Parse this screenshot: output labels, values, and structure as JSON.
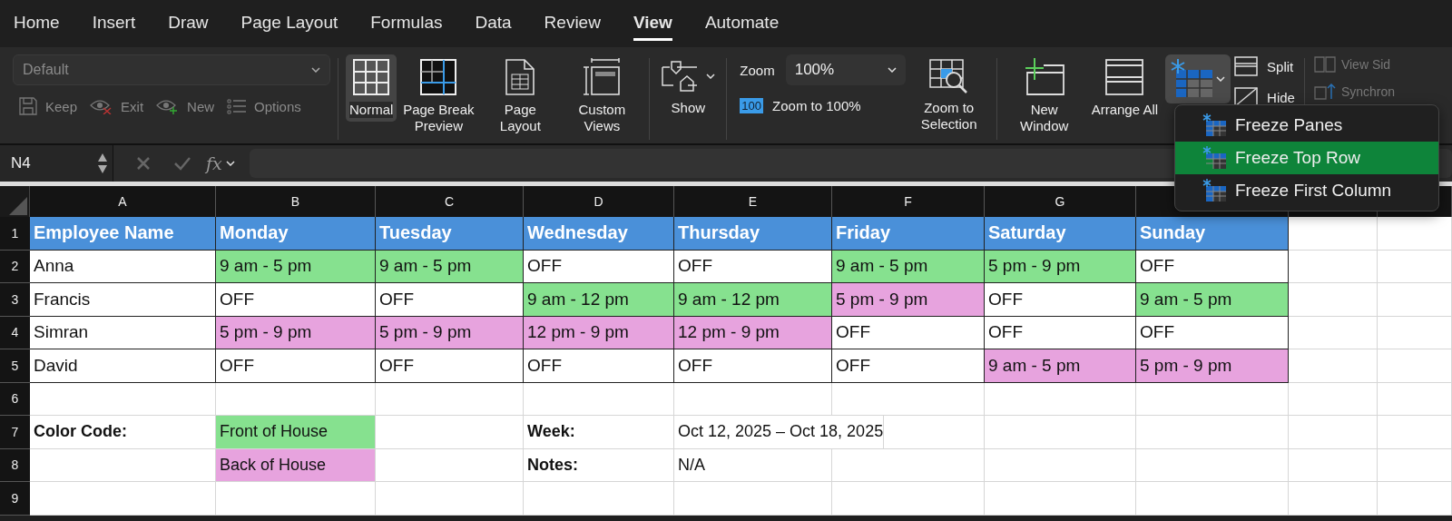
{
  "menu_tabs": [
    {
      "label": "Home",
      "selected": false
    },
    {
      "label": "Insert",
      "selected": false
    },
    {
      "label": "Draw",
      "selected": false
    },
    {
      "label": "Page Layout",
      "selected": false
    },
    {
      "label": "Formulas",
      "selected": false
    },
    {
      "label": "Data",
      "selected": false
    },
    {
      "label": "Review",
      "selected": false
    },
    {
      "label": "View",
      "selected": true
    },
    {
      "label": "Automate",
      "selected": false
    }
  ],
  "sheet_view": {
    "value": "Default",
    "actions": [
      "Keep",
      "Exit",
      "New",
      "Options"
    ]
  },
  "workbook_views": [
    {
      "label": "Normal",
      "selected": true
    },
    {
      "label": "Page Break Preview",
      "selected": false
    },
    {
      "label": "Page Layout",
      "selected": false
    },
    {
      "label": "Custom Views",
      "selected": false
    }
  ],
  "show": {
    "label": "Show"
  },
  "zoom": {
    "label": "Zoom",
    "value": "100%",
    "zoom_100_badge": "100",
    "zoom_100_label": "Zoom to 100%",
    "zoom_selection": "Zoom to Selection"
  },
  "window": {
    "new_window": "New Window",
    "arrange_all": "Arrange All",
    "freeze_open": true,
    "split": "Split",
    "hide": "Hide",
    "view_side": "View Sid",
    "synchronous": "Synchron"
  },
  "freeze_menu": [
    {
      "label": "Freeze Panes",
      "selected": false
    },
    {
      "label": "Freeze Top Row",
      "selected": true
    },
    {
      "label": "Freeze First Column",
      "selected": false
    }
  ],
  "formula_bar": {
    "name_box": "N4",
    "fx": "fx"
  },
  "columns": [
    "A",
    "B",
    "C",
    "D",
    "E",
    "F",
    "G"
  ],
  "rows": [
    {
      "number": "1",
      "cells": [
        {
          "text": "Employee Name",
          "kind": "header",
          "color": "#4a90d9"
        },
        {
          "text": "Monday",
          "kind": "header",
          "color": "#4a90d9"
        },
        {
          "text": "Tuesday",
          "kind": "header",
          "color": "#4a90d9"
        },
        {
          "text": "Wednesday",
          "kind": "header",
          "color": "#4a90d9"
        },
        {
          "text": "Thursday",
          "kind": "header",
          "color": "#4a90d9"
        },
        {
          "text": "Friday",
          "kind": "header",
          "color": "#4a90d9"
        },
        {
          "text": "Saturday",
          "kind": "header",
          "color": "#4a90d9"
        },
        {
          "text": "Sunday",
          "kind": "header",
          "color": "#4a90d9"
        }
      ]
    },
    {
      "number": "2",
      "cells": [
        {
          "text": "Anna",
          "kind": "entry"
        },
        {
          "text": "9 am - 5 pm",
          "kind": "entry",
          "color": "#86e18f"
        },
        {
          "text": "9 am - 5 pm",
          "kind": "entry",
          "color": "#86e18f"
        },
        {
          "text": "OFF",
          "kind": "entry"
        },
        {
          "text": "OFF",
          "kind": "entry"
        },
        {
          "text": "9 am - 5 pm",
          "kind": "entry",
          "color": "#86e18f"
        },
        {
          "text": "5 pm - 9 pm",
          "kind": "entry",
          "color": "#86e18f"
        },
        {
          "text": "OFF",
          "kind": "entry"
        }
      ]
    },
    {
      "number": "3",
      "cells": [
        {
          "text": "Francis",
          "kind": "entry"
        },
        {
          "text": "OFF",
          "kind": "entry"
        },
        {
          "text": "OFF",
          "kind": "entry"
        },
        {
          "text": "9 am - 12 pm",
          "kind": "entry",
          "color": "#86e18f"
        },
        {
          "text": "9 am - 12 pm",
          "kind": "entry",
          "color": "#86e18f"
        },
        {
          "text": "5 pm - 9 pm",
          "kind": "entry",
          "color": "#e7a3de"
        },
        {
          "text": "OFF",
          "kind": "entry"
        },
        {
          "text": "9 am - 5 pm",
          "kind": "entry",
          "color": "#86e18f"
        }
      ]
    },
    {
      "number": "4",
      "cells": [
        {
          "text": "Simran",
          "kind": "entry"
        },
        {
          "text": "5 pm - 9 pm",
          "kind": "entry",
          "color": "#e7a3de"
        },
        {
          "text": "5 pm - 9 pm",
          "kind": "entry",
          "color": "#e7a3de"
        },
        {
          "text": "12 pm - 9 pm",
          "kind": "entry",
          "color": "#e7a3de"
        },
        {
          "text": "12 pm - 9 pm",
          "kind": "entry",
          "color": "#e7a3de"
        },
        {
          "text": "OFF",
          "kind": "entry"
        },
        {
          "text": "OFF",
          "kind": "entry"
        },
        {
          "text": "OFF",
          "kind": "entry"
        }
      ]
    },
    {
      "number": "5",
      "cells": [
        {
          "text": "David",
          "kind": "entry"
        },
        {
          "text": "OFF",
          "kind": "entry"
        },
        {
          "text": "OFF",
          "kind": "entry"
        },
        {
          "text": "OFF",
          "kind": "entry"
        },
        {
          "text": "OFF",
          "kind": "entry"
        },
        {
          "text": "OFF",
          "kind": "entry"
        },
        {
          "text": "9 am - 5 pm",
          "kind": "entry",
          "color": "#e7a3de"
        },
        {
          "text": "5 pm - 9 pm",
          "kind": "entry",
          "color": "#e7a3de"
        }
      ]
    },
    {
      "number": "6",
      "cells": []
    },
    {
      "number": "7",
      "cells": [
        {
          "text": "Color Code:",
          "kind": "label"
        },
        {
          "text": "Front of House",
          "kind": "value",
          "color": "#86e18f"
        },
        {
          "kind": "blank"
        },
        {
          "text": "Week:",
          "kind": "label"
        },
        {
          "text": "Oct 12, 2025 – Oct 18, 2025",
          "kind": "value"
        }
      ]
    },
    {
      "number": "8",
      "cells": [
        {
          "kind": "blank"
        },
        {
          "text": "Back of House",
          "kind": "value",
          "color": "#e7a3de"
        },
        {
          "kind": "blank"
        },
        {
          "text": "Notes:",
          "kind": "label"
        },
        {
          "text": "N/A",
          "kind": "value"
        }
      ]
    },
    {
      "number": "9",
      "cells": []
    }
  ]
}
